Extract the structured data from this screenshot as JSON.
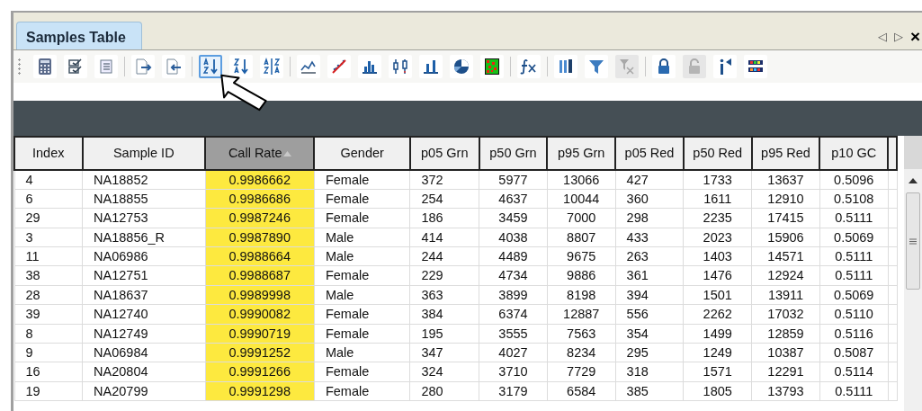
{
  "tab": {
    "label": "Samples Table",
    "selected": true
  },
  "tab_nav": [
    "◁",
    "▷",
    "×"
  ],
  "toolbar": [
    {
      "kind": "button",
      "selected": false,
      "disabled": false
    },
    {
      "kind": "button",
      "selected": false,
      "disabled": false
    },
    {
      "kind": "button",
      "selected": false,
      "disabled": false
    },
    {
      "kind": "separator"
    },
    {
      "kind": "button",
      "selected": false,
      "disabled": false
    },
    {
      "kind": "button",
      "selected": false,
      "disabled": false
    },
    {
      "kind": "separator"
    },
    {
      "kind": "button",
      "selected": true,
      "disabled": false
    },
    {
      "kind": "button",
      "selected": false,
      "disabled": false
    },
    {
      "kind": "button",
      "selected": false,
      "disabled": false
    },
    {
      "kind": "separator"
    },
    {
      "kind": "button",
      "selected": false,
      "disabled": false
    },
    {
      "kind": "button",
      "selected": false,
      "disabled": false
    },
    {
      "kind": "button",
      "selected": false,
      "disabled": false
    },
    {
      "kind": "button",
      "selected": false,
      "disabled": false
    },
    {
      "kind": "button",
      "selected": false,
      "disabled": false
    },
    {
      "kind": "button",
      "selected": false,
      "disabled": false
    },
    {
      "kind": "button",
      "selected": false,
      "disabled": false
    },
    {
      "kind": "separator"
    },
    {
      "kind": "button",
      "selected": false,
      "disabled": false
    },
    {
      "kind": "separator"
    },
    {
      "kind": "button",
      "selected": false,
      "disabled": false
    },
    {
      "kind": "button",
      "selected": false,
      "disabled": false
    },
    {
      "kind": "button",
      "selected": false,
      "disabled": true
    },
    {
      "kind": "separator"
    },
    {
      "kind": "button",
      "selected": false,
      "disabled": false
    },
    {
      "kind": "button",
      "selected": false,
      "disabled": true
    },
    {
      "kind": "button",
      "selected": false,
      "disabled": false
    },
    {
      "kind": "button",
      "selected": false,
      "disabled": false
    }
  ],
  "table": {
    "columns": [
      {
        "label": "Index",
        "sorted": false
      },
      {
        "label": "Sample ID",
        "sorted": false
      },
      {
        "label": "Call Rate",
        "sorted": true
      },
      {
        "label": "Gender",
        "sorted": false
      },
      {
        "label": "p05 Grn",
        "sorted": false
      },
      {
        "label": "p50 Grn",
        "sorted": false
      },
      {
        "label": "p95 Grn",
        "sorted": false
      },
      {
        "label": "p05 Red",
        "sorted": false
      },
      {
        "label": "p50 Red",
        "sorted": false
      },
      {
        "label": "p95 Red",
        "sorted": false
      },
      {
        "label": "p10 GC",
        "sorted": false
      }
    ],
    "rows": [
      [
        "4",
        "NA18852",
        "0.9986662",
        "Female",
        "372",
        "5977",
        "13066",
        "427",
        "1733",
        "13637",
        "0.5096"
      ],
      [
        "6",
        "NA18855",
        "0.9986686",
        "Female",
        "254",
        "4637",
        "10044",
        "360",
        "1611",
        "12910",
        "0.5108"
      ],
      [
        "29",
        "NA12753",
        "0.9987246",
        "Female",
        "186",
        "3459",
        "7000",
        "298",
        "2235",
        "17415",
        "0.5111"
      ],
      [
        "3",
        "NA18856_R",
        "0.9987890",
        "Male",
        "414",
        "4038",
        "8807",
        "433",
        "2023",
        "15906",
        "0.5069"
      ],
      [
        "11",
        "NA06986",
        "0.9988664",
        "Male",
        "244",
        "4489",
        "9675",
        "263",
        "1403",
        "14571",
        "0.5111"
      ],
      [
        "38",
        "NA12751",
        "0.9988687",
        "Female",
        "229",
        "4734",
        "9886",
        "361",
        "1476",
        "12924",
        "0.5111"
      ],
      [
        "28",
        "NA18637",
        "0.9989998",
        "Male",
        "363",
        "3899",
        "8198",
        "394",
        "1501",
        "13911",
        "0.5069"
      ],
      [
        "39",
        "NA12740",
        "0.9990082",
        "Female",
        "384",
        "6374",
        "12887",
        "556",
        "2262",
        "17032",
        "0.5110"
      ],
      [
        "8",
        "NA12749",
        "0.9990719",
        "Female",
        "195",
        "3555",
        "7563",
        "354",
        "1499",
        "12859",
        "0.5116"
      ],
      [
        "9",
        "NA06984",
        "0.9991252",
        "Male",
        "347",
        "4027",
        "8234",
        "295",
        "1249",
        "10387",
        "0.5087"
      ],
      [
        "16",
        "NA20804",
        "0.9991266",
        "Female",
        "324",
        "3710",
        "7729",
        "318",
        "1571",
        "12291",
        "0.5114"
      ],
      [
        "19",
        "NA20799",
        "0.9991298",
        "Female",
        "280",
        "3179",
        "6584",
        "385",
        "1805",
        "13793",
        "0.5111"
      ]
    ]
  }
}
